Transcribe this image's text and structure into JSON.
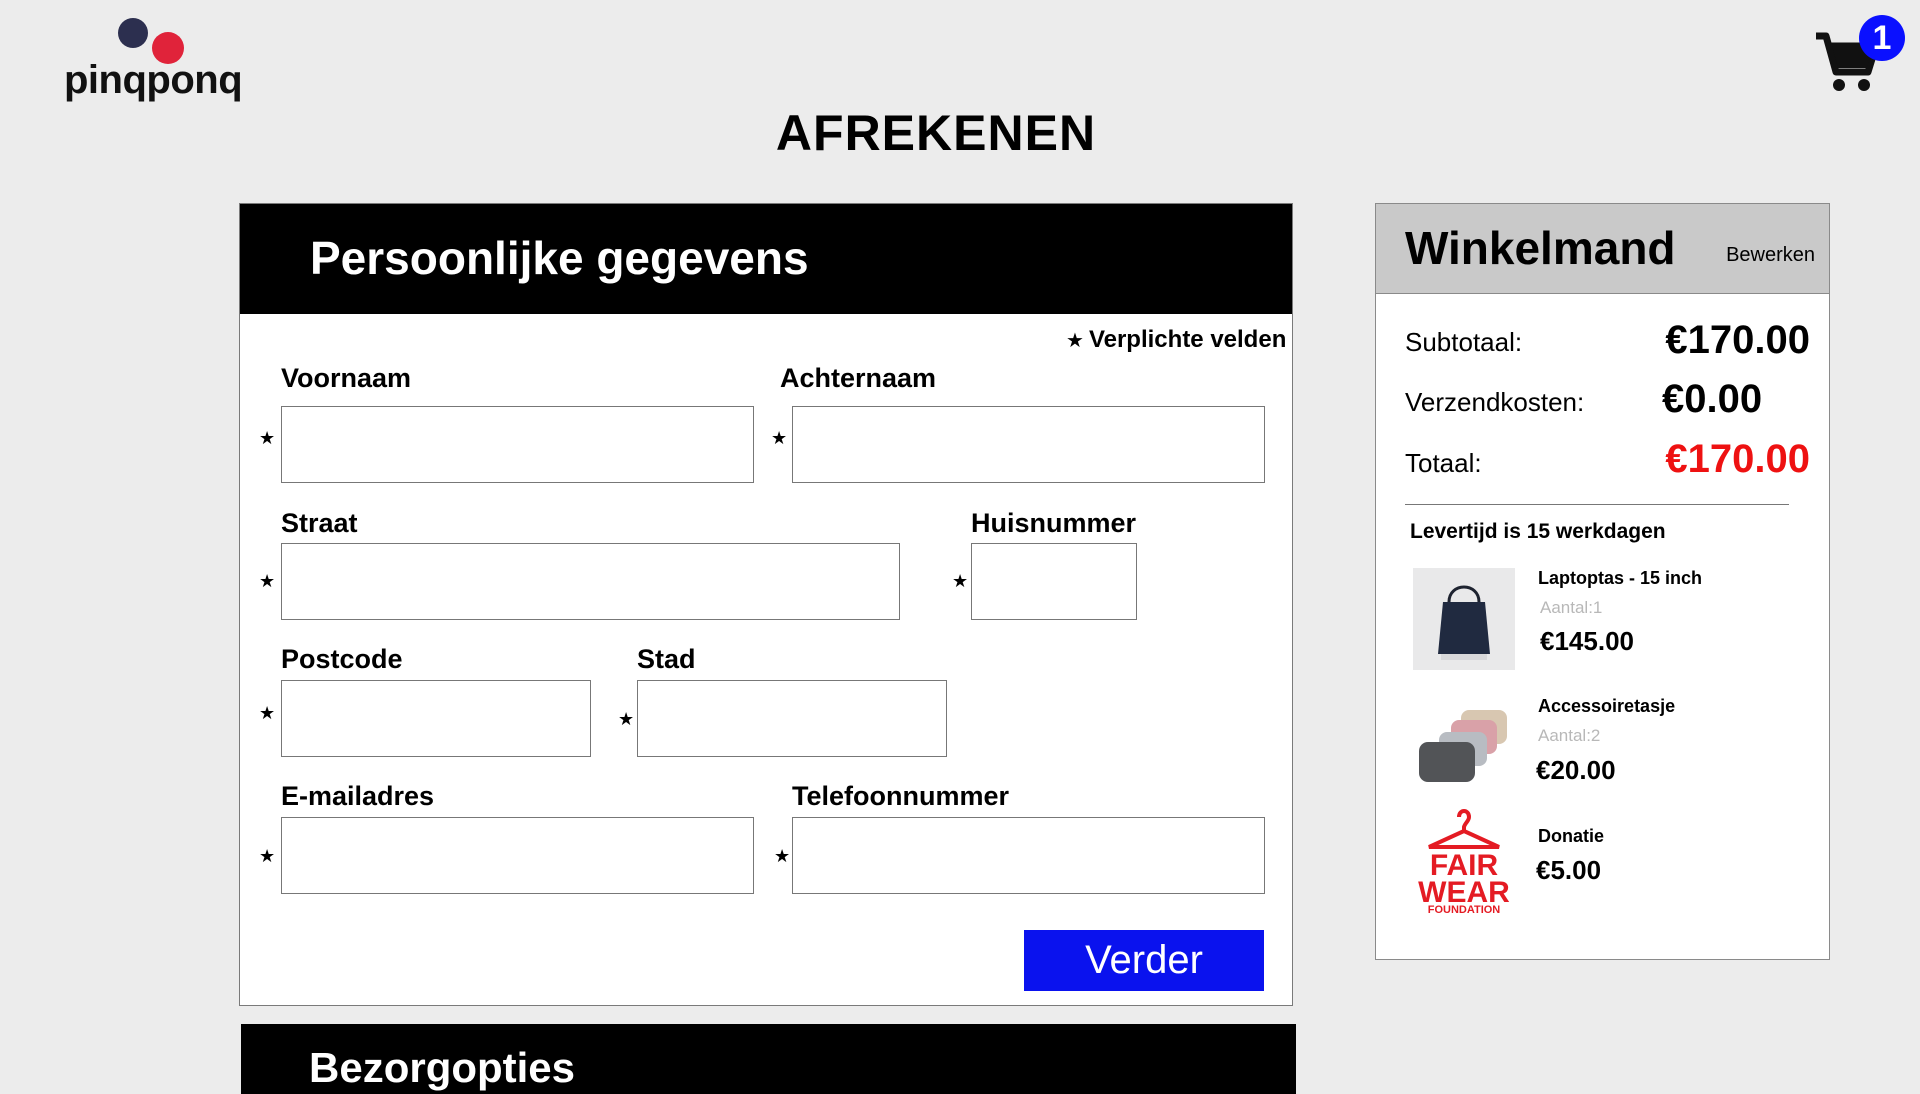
{
  "header": {
    "logo_text": "pinqponq",
    "cart_count": "1",
    "page_title": "AFREKENEN"
  },
  "personal": {
    "title": "Persoonlijke gegevens",
    "required_note": "Verplichte velden",
    "required_symbol": "★",
    "fields": {
      "voornaam": {
        "label": "Voornaam",
        "value": ""
      },
      "achternaam": {
        "label": "Achternaam",
        "value": ""
      },
      "straat": {
        "label": "Straat",
        "value": ""
      },
      "huisnummer": {
        "label": "Huisnummer",
        "value": ""
      },
      "postcode": {
        "label": "Postcode",
        "value": ""
      },
      "stad": {
        "label": "Stad",
        "value": ""
      },
      "email": {
        "label": "E-mailadres",
        "value": ""
      },
      "telefoon": {
        "label": "Telefoonnummer",
        "value": ""
      }
    },
    "next_button": "Verder"
  },
  "delivery_panel": {
    "title": "Bezorgopties"
  },
  "cart": {
    "title": "Winkelmand",
    "edit_label": "Bewerken",
    "subtotal_label": "Subtotaal:",
    "subtotal_value": "€170.00",
    "shipping_label": "Verzendkosten:",
    "shipping_value": "€0.00",
    "total_label": "Totaal:",
    "total_value": "€170.00",
    "delivery_time": "Levertijd is 15 werkdagen",
    "items": [
      {
        "name": "Laptoptas - 15 inch",
        "qty": "Aantal:1",
        "price": "€145.00",
        "icon": "laptop-bag-image"
      },
      {
        "name": "Accessoiretasje",
        "qty": "Aantal:2",
        "price": "€20.00",
        "icon": "pouch-image"
      },
      {
        "name": "Donatie",
        "price": "€5.00",
        "icon": "fair-wear-logo",
        "logo_text": [
          "FAIR",
          "WEAR",
          "FOUNDATION"
        ]
      }
    ]
  },
  "colors": {
    "accent_blue": "#0a12ee",
    "total_red": "#ee1111",
    "background": "#ececec"
  }
}
